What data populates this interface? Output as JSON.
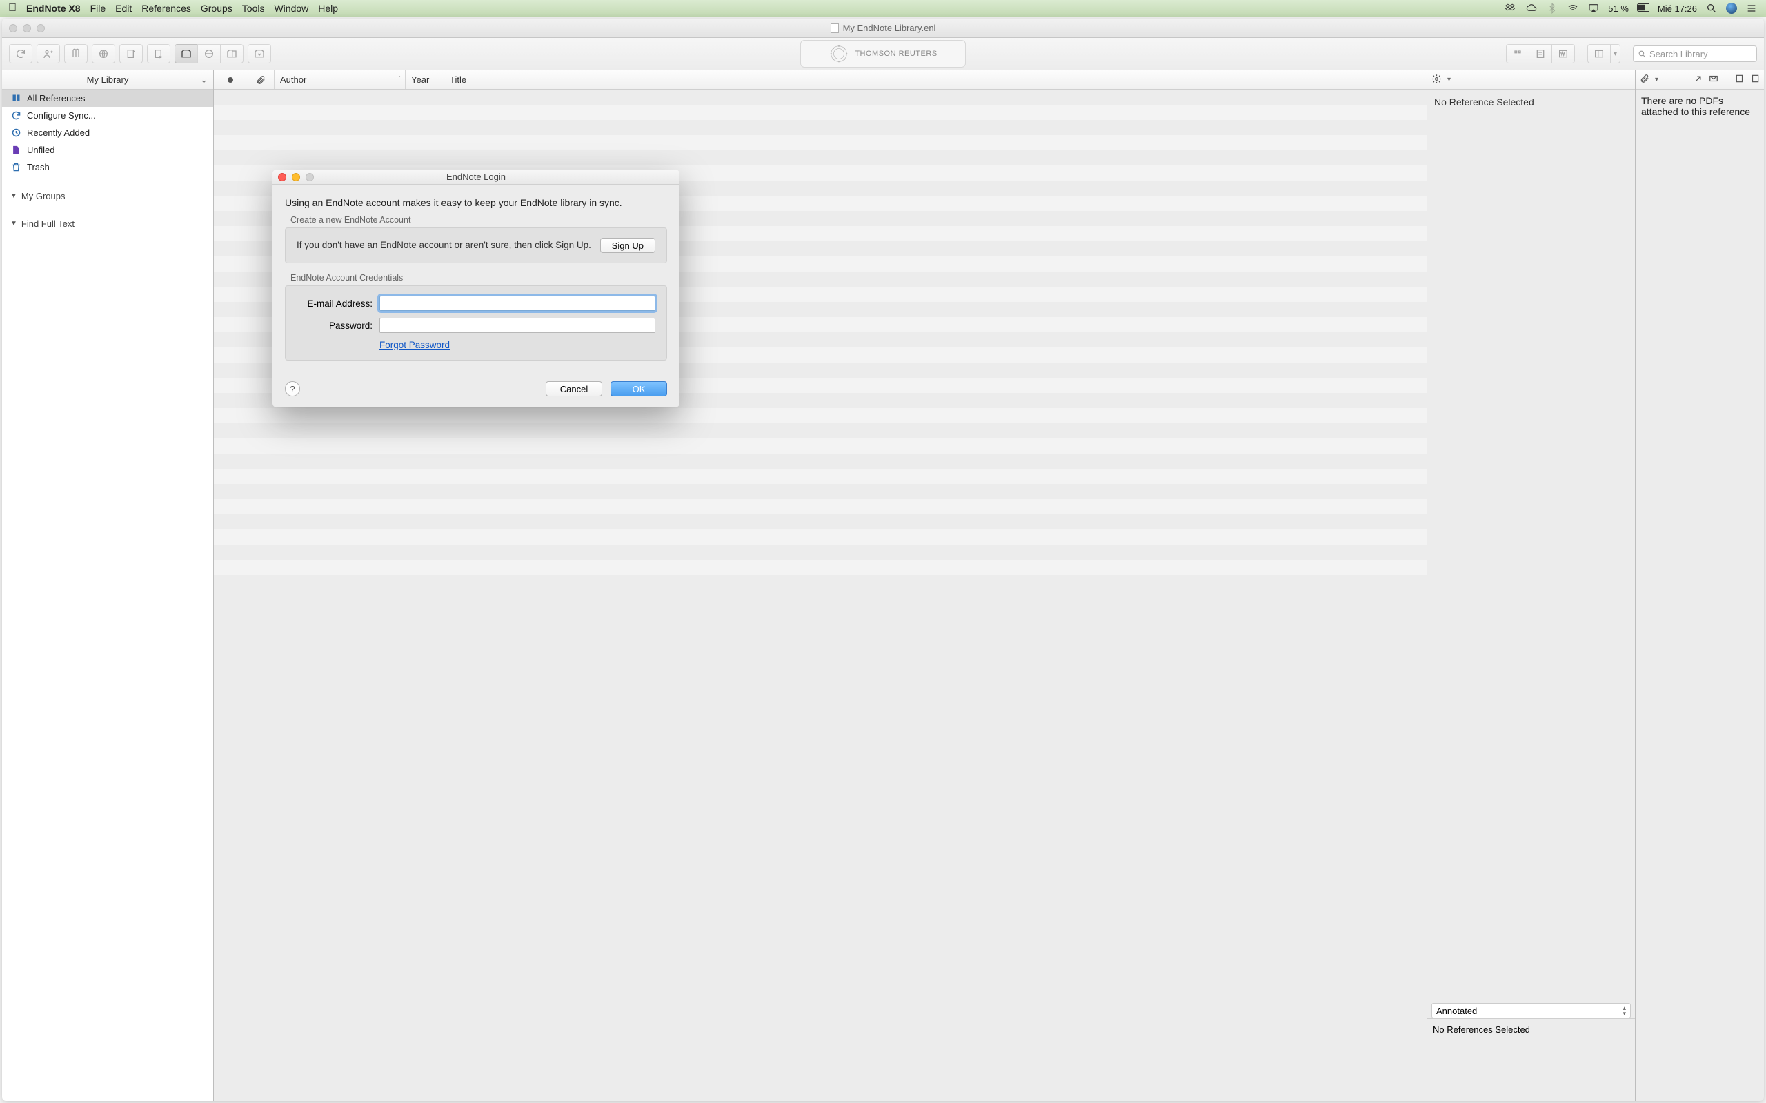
{
  "menubar": {
    "app_name": "EndNote X8",
    "items": [
      "File",
      "Edit",
      "References",
      "Groups",
      "Tools",
      "Window",
      "Help"
    ],
    "battery_pct": "51 %",
    "clock": "Mié 17:26"
  },
  "window": {
    "doc_title": "My EndNote Library.enl",
    "brand": "THOMSON REUTERS",
    "search_placeholder": "Search Library"
  },
  "sidebar": {
    "header_label": "My Library",
    "items": [
      {
        "label": "All References",
        "icon": "book",
        "color": "#2f6fb0",
        "selected": true
      },
      {
        "label": "Configure Sync...",
        "icon": "sync",
        "color": "#2f6fb0",
        "selected": false
      },
      {
        "label": "Recently Added",
        "icon": "clock",
        "color": "#2f6fb0",
        "selected": false
      },
      {
        "label": "Unfiled",
        "icon": "file",
        "color": "#6a3db5",
        "selected": false
      },
      {
        "label": "Trash",
        "icon": "trash",
        "color": "#2f6fb0",
        "selected": false
      }
    ],
    "groups": [
      {
        "label": "My Groups"
      },
      {
        "label": "Find Full Text"
      }
    ]
  },
  "columns": {
    "author": "Author",
    "year": "Year",
    "title": "Title"
  },
  "rightpane": {
    "no_ref": "No Reference Selected",
    "annotated": "Annotated",
    "no_refs_selected": "No References Selected"
  },
  "pdfpane": {
    "no_pdf": "There are no PDFs attached to this reference"
  },
  "modal": {
    "title": "EndNote Login",
    "intro": "Using an EndNote account makes it easy to keep your EndNote library in sync.",
    "create_section": "Create a new EndNote Account",
    "signup_text": "If you don't have an EndNote account or aren't sure, then click Sign Up.",
    "signup_btn": "Sign Up",
    "creds_section": "EndNote Account Credentials",
    "email_label": "E-mail Address:",
    "password_label": "Password:",
    "forgot": "Forgot Password",
    "cancel": "Cancel",
    "ok": "OK"
  }
}
